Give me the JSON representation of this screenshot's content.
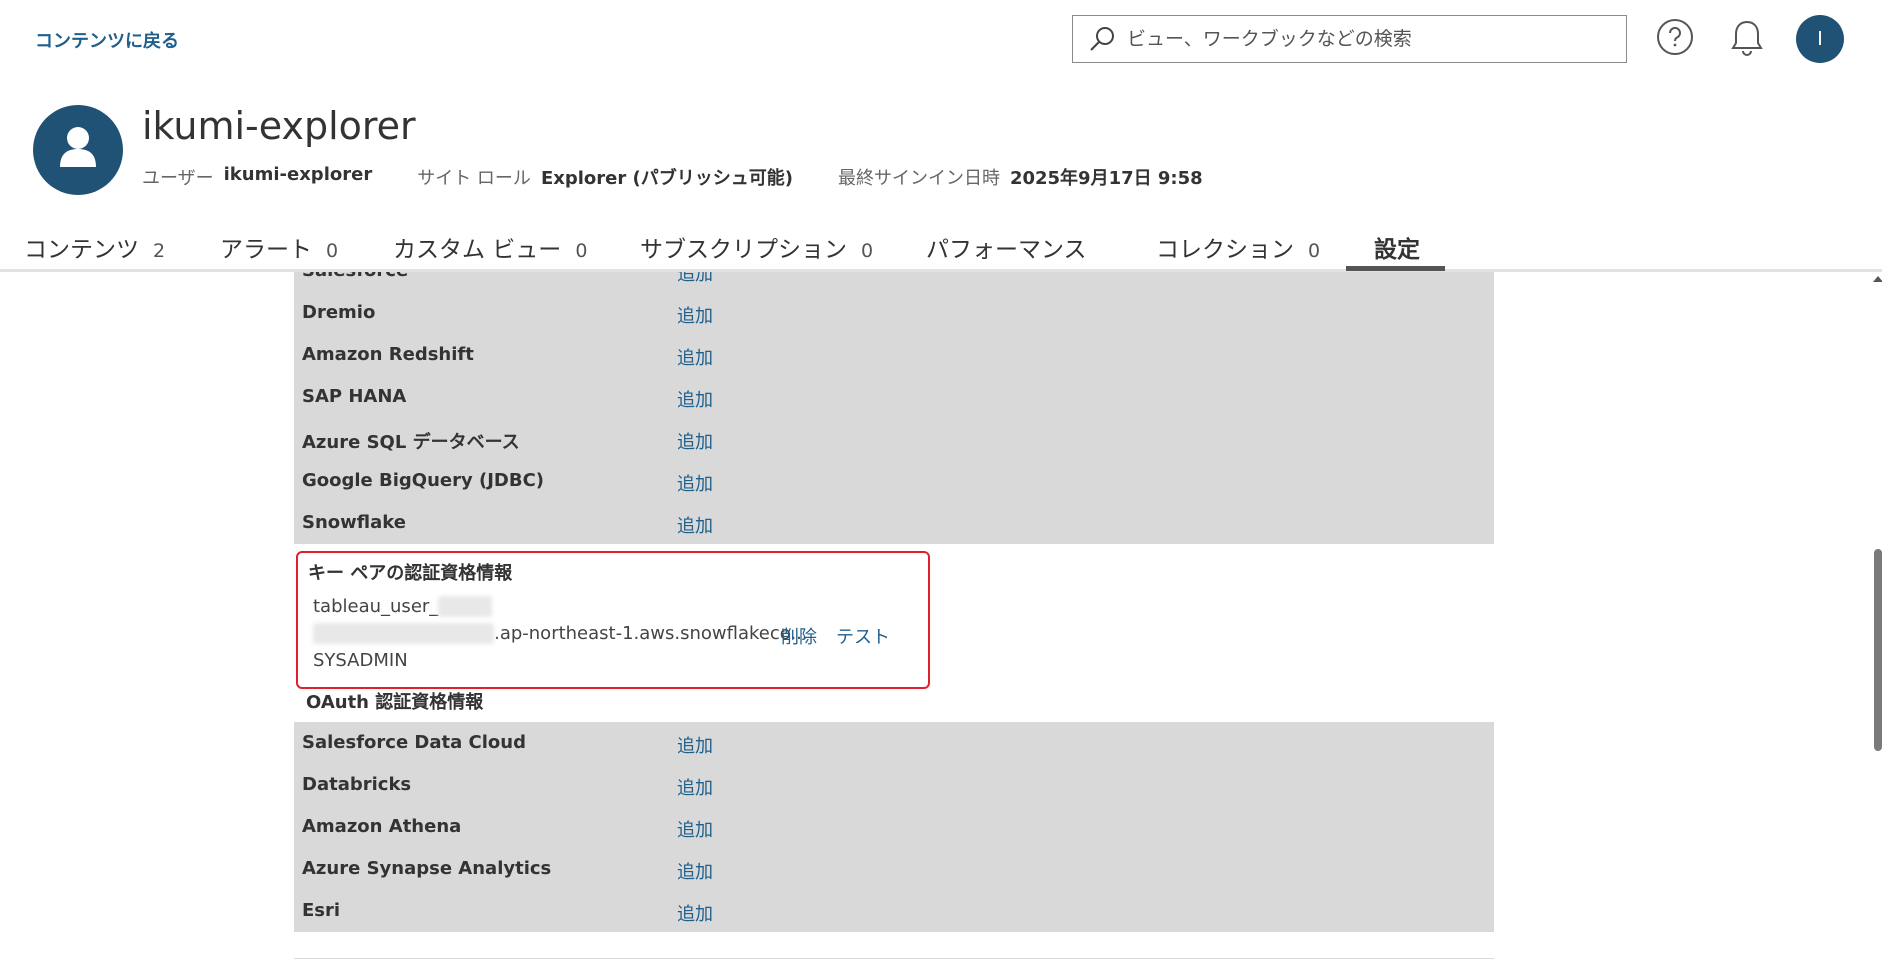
{
  "header": {
    "back_link": "コンテンツに戻る",
    "search_placeholder": "ビュー、ワークブックなどの検索",
    "user_initial": "I"
  },
  "profile": {
    "name": "ikumi-explorer",
    "user_label": "ユーザー",
    "user_value": "ikumi-explorer",
    "role_label": "サイト ロール",
    "role_value": "Explorer (パブリッシュ可能)",
    "signin_label": "最終サインイン日時",
    "signin_value": "2025年9月17日 9:58"
  },
  "tabs": [
    {
      "label": "コンテンツ",
      "count": "2"
    },
    {
      "label": "アラート",
      "count": "0"
    },
    {
      "label": "カスタム ビュー",
      "count": "0"
    },
    {
      "label": "サブスクリプション",
      "count": "0"
    },
    {
      "label": "パフォーマンス",
      "count": ""
    },
    {
      "label": "コレクション",
      "count": "0"
    },
    {
      "label": "設定",
      "count": ""
    }
  ],
  "connections_top": [
    {
      "name": "Salesforce",
      "action": "追加"
    },
    {
      "name": "Dremio",
      "action": "追加"
    },
    {
      "name": "Amazon Redshift",
      "action": "追加"
    },
    {
      "name": "SAP HANA",
      "action": "追加"
    },
    {
      "name": "Azure SQL データベース",
      "action": "追加"
    },
    {
      "name": "Google BigQuery (JDBC)",
      "action": "追加"
    },
    {
      "name": "Snowflake",
      "action": "追加"
    }
  ],
  "keypair": {
    "title": "キー ペアの認証資格情報",
    "user_prefix": "tableau_user_",
    "host_suffix": ".ap-northeast-1.aws.snowflakeco...",
    "role": "SYSADMIN",
    "delete_label": "削除",
    "test_label": "テスト"
  },
  "oauth": {
    "title": "OAuth 認証資格情報"
  },
  "connections_oauth": [
    {
      "name": "Salesforce Data Cloud",
      "action": "追加"
    },
    {
      "name": "Databricks",
      "action": "追加"
    },
    {
      "name": "Amazon Athena",
      "action": "追加"
    },
    {
      "name": "Azure Synapse Analytics",
      "action": "追加"
    },
    {
      "name": "Esri",
      "action": "追加"
    }
  ]
}
